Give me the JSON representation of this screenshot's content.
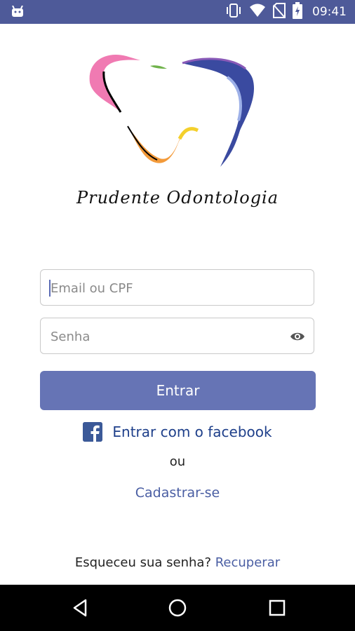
{
  "status_bar": {
    "time": "09:41",
    "icons": [
      "android-icon",
      "vibrate-icon",
      "wifi-icon",
      "no-sim-icon",
      "battery-icon"
    ]
  },
  "brand": {
    "name": "Prudente Odontologia",
    "logo": "tooth-logo"
  },
  "form": {
    "email_placeholder": "Email ou CPF",
    "password_placeholder": "Senha",
    "enter_label": "Entrar",
    "facebook_label": "Entrar com o facebook",
    "or_label": "ou",
    "signup_label": "Cadastrar-se",
    "forgot_text": "Esqueceu sua senha?",
    "recover_label": "Recuperar"
  },
  "nav_bar": {
    "buttons": [
      "back-icon",
      "home-icon",
      "recents-icon"
    ]
  },
  "colors": {
    "status_bar": "#4e5a99",
    "primary_button": "#6674b5",
    "link": "#4a5ea3",
    "facebook": "#3b5998"
  }
}
